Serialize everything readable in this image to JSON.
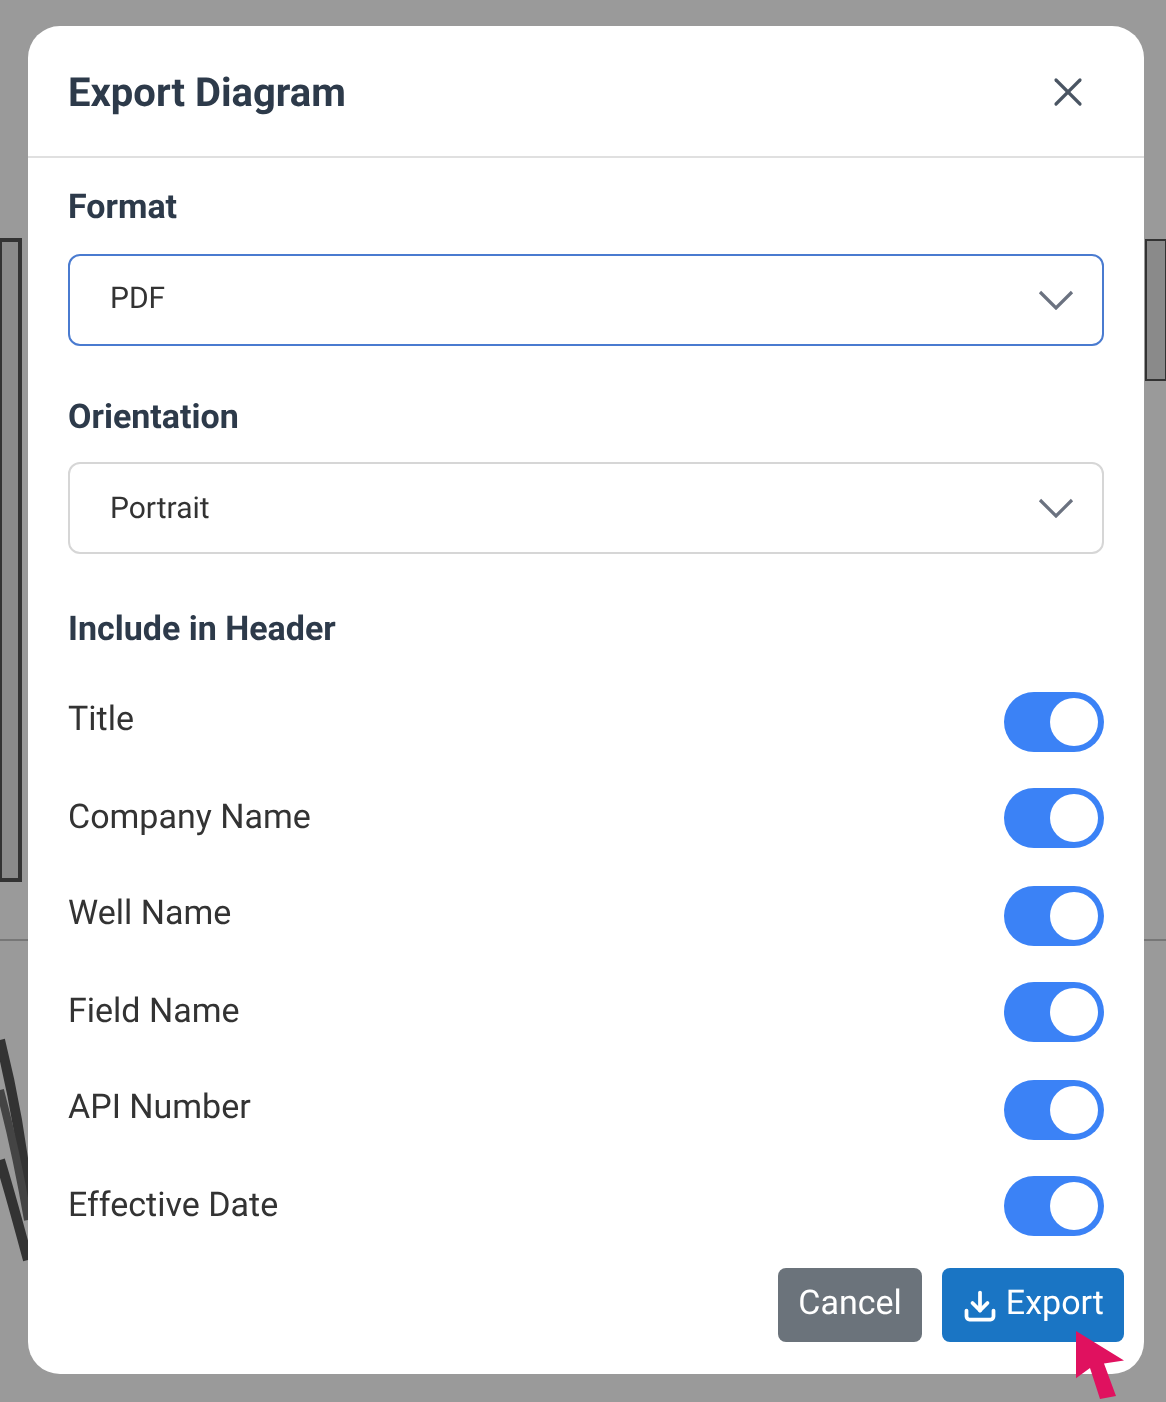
{
  "dialog": {
    "title": "Export Diagram",
    "fields": [
      {
        "label": "Format",
        "value": "PDF",
        "focused": true
      },
      {
        "label": "Orientation",
        "value": "Portrait",
        "focused": false
      }
    ],
    "section": "Include in Header",
    "toggles": [
      {
        "label": "Title",
        "on": true
      },
      {
        "label": "Company Name",
        "on": true
      },
      {
        "label": "Well Name",
        "on": true
      },
      {
        "label": "Field Name",
        "on": true
      },
      {
        "label": "API Number",
        "on": true
      },
      {
        "label": "Effective Date",
        "on": true
      }
    ],
    "buttons": [
      {
        "label": "Cancel",
        "kind": "secondary"
      },
      {
        "label": "Export",
        "kind": "primary"
      }
    ]
  }
}
